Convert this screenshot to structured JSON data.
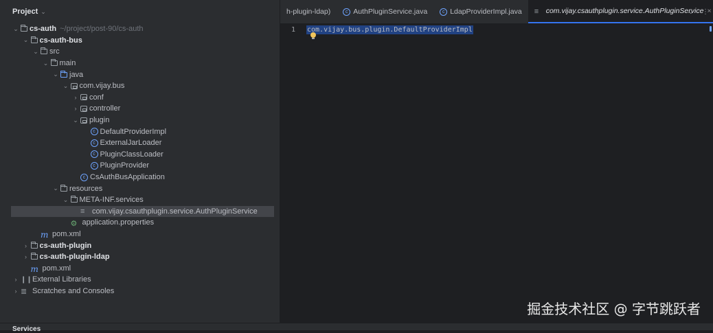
{
  "project": {
    "title": "Project",
    "tree": [
      {
        "depth": 0,
        "arrow": "v",
        "icon": "folder",
        "label": "cs-auth",
        "bold": true,
        "hint": "~/project/post-90/cs-auth"
      },
      {
        "depth": 1,
        "arrow": "v",
        "icon": "folder",
        "label": "cs-auth-bus",
        "bold": true
      },
      {
        "depth": 2,
        "arrow": "v",
        "icon": "folder",
        "label": "src"
      },
      {
        "depth": 3,
        "arrow": "v",
        "icon": "folder",
        "label": "main"
      },
      {
        "depth": 4,
        "arrow": "v",
        "icon": "folder-blue",
        "label": "java"
      },
      {
        "depth": 5,
        "arrow": "v",
        "icon": "package",
        "label": "com.vijay.bus"
      },
      {
        "depth": 6,
        "arrow": ">",
        "icon": "package",
        "label": "conf"
      },
      {
        "depth": 6,
        "arrow": ">",
        "icon": "package",
        "label": "controller"
      },
      {
        "depth": 6,
        "arrow": "v",
        "icon": "package",
        "label": "plugin"
      },
      {
        "depth": 7,
        "arrow": "",
        "icon": "class",
        "label": "DefaultProviderImpl"
      },
      {
        "depth": 7,
        "arrow": "",
        "icon": "class",
        "label": "ExternalJarLoader"
      },
      {
        "depth": 7,
        "arrow": "",
        "icon": "class",
        "label": "PluginClassLoader"
      },
      {
        "depth": 7,
        "arrow": "",
        "icon": "class",
        "label": "PluginProvider"
      },
      {
        "depth": 6,
        "arrow": "",
        "icon": "class",
        "label": "CsAuthBusApplication"
      },
      {
        "depth": 4,
        "arrow": "v",
        "icon": "folder",
        "label": "resources"
      },
      {
        "depth": 5,
        "arrow": "v",
        "icon": "folder",
        "label": "META-INF.services"
      },
      {
        "depth": 6,
        "arrow": "",
        "icon": "lines",
        "label": "com.vijay.csauthplugin.service.AuthPluginService",
        "selected": true
      },
      {
        "depth": 5,
        "arrow": "",
        "icon": "props",
        "label": "application.properties"
      },
      {
        "depth": 2,
        "arrow": "",
        "icon": "maven",
        "label": "pom.xml"
      },
      {
        "depth": 1,
        "arrow": ">",
        "icon": "folder",
        "label": "cs-auth-plugin",
        "bold": true
      },
      {
        "depth": 1,
        "arrow": ">",
        "icon": "folder",
        "label": "cs-auth-plugin-ldap",
        "bold": true
      },
      {
        "depth": 1,
        "arrow": "",
        "icon": "maven",
        "label": "pom.xml"
      },
      {
        "depth": 0,
        "arrow": ">",
        "icon": "library",
        "label": "External Libraries"
      },
      {
        "depth": 0,
        "arrow": ">",
        "icon": "scratches",
        "label": "Scratches and Consoles"
      }
    ]
  },
  "services": {
    "title": "Services"
  },
  "editor": {
    "tabs": [
      {
        "label": "h-plugin-ldap)",
        "icon": ""
      },
      {
        "label": "AuthPluginService.java",
        "icon": "interface"
      },
      {
        "label": "LdapProviderImpl.java",
        "icon": "class"
      },
      {
        "label": "com.vijay.csauthplugin.service.AuthPluginService",
        "icon": "lines",
        "active": true
      }
    ],
    "line_number": "1",
    "code": "com.vijay.bus.plugin.DefaultProviderImpl"
  },
  "watermark": "掘金技术社区 @ 字节跳跃者"
}
